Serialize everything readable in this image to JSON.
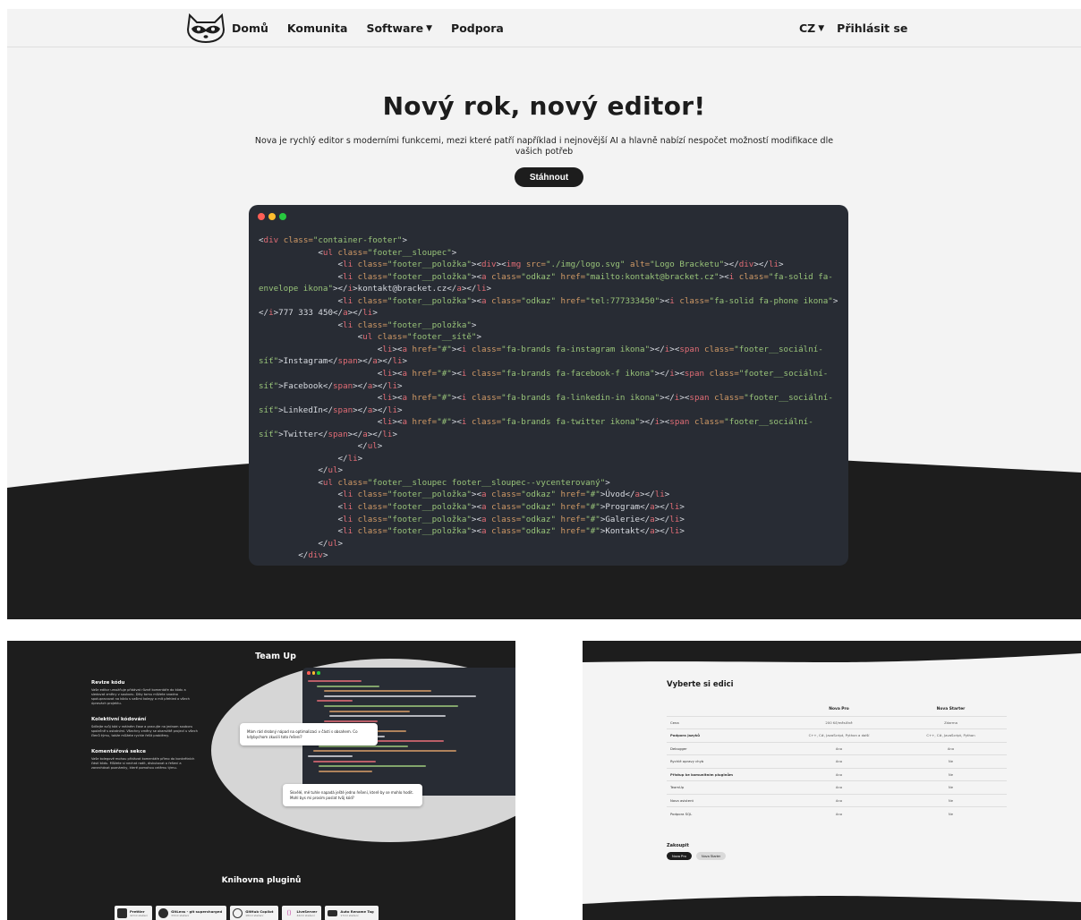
{
  "nav": {
    "items": [
      {
        "label": "Domů"
      },
      {
        "label": "Komunita"
      },
      {
        "label": "Software",
        "caret": "▼"
      },
      {
        "label": "Podpora"
      }
    ],
    "language": {
      "label": "CZ",
      "caret": "▼"
    },
    "login": "Přihlásit se"
  },
  "hero": {
    "title": "Nový rok, nový editor!",
    "subtitle": "Nova je rychlý editor s moderními funkcemi, mezi které patří například i nejnovější AI a hlavně nabízí nespočet možností modifikace dle vašich potřeb",
    "download_button": "Stáhnout"
  },
  "code_window": {
    "dots": [
      "#ff5f56",
      "#ffbd2e",
      "#27c93f"
    ],
    "lines": [
      [
        [
          "t",
          "<"
        ],
        [
          "r",
          "div "
        ],
        [
          "a",
          "class="
        ],
        [
          "s",
          "\"container-footer\""
        ],
        [
          "t",
          ">"
        ]
      ],
      [
        [
          "t",
          "            <"
        ],
        [
          "r",
          "ul "
        ],
        [
          "a",
          "class="
        ],
        [
          "s",
          "\"footer__sloupec\""
        ],
        [
          "t",
          ">"
        ]
      ],
      [
        [
          "t",
          "                <"
        ],
        [
          "r",
          "li "
        ],
        [
          "a",
          "class="
        ],
        [
          "s",
          "\"footer__položka\""
        ],
        [
          "t",
          "><"
        ],
        [
          "r",
          "div"
        ],
        [
          "t",
          "><"
        ],
        [
          "r",
          "img "
        ],
        [
          "a",
          "src="
        ],
        [
          "s",
          "\"./img/logo.svg\" "
        ],
        [
          "a",
          "alt="
        ],
        [
          "s",
          "\"Logo Bracketu\""
        ],
        [
          "t",
          "></"
        ],
        [
          "r",
          "div"
        ],
        [
          "t",
          "></"
        ],
        [
          "r",
          "li"
        ],
        [
          "t",
          ">"
        ]
      ],
      [
        [
          "t",
          "                <"
        ],
        [
          "r",
          "li "
        ],
        [
          "a",
          "class="
        ],
        [
          "s",
          "\"footer__položka\""
        ],
        [
          "t",
          "><"
        ],
        [
          "r",
          "a "
        ],
        [
          "a",
          "class="
        ],
        [
          "s",
          "\"odkaz\" "
        ],
        [
          "a",
          "href="
        ],
        [
          "s",
          "\"mailto:kontakt@bracket.cz\""
        ],
        [
          "t",
          "><"
        ],
        [
          "r",
          "i "
        ],
        [
          "a",
          "class="
        ],
        [
          "s",
          "\"fa-solid fa-"
        ]
      ],
      [
        [
          "s",
          "envelope ikona\""
        ],
        [
          "t",
          "></"
        ],
        [
          "r",
          "i"
        ],
        [
          "t",
          ">kontakt@bracket.cz</"
        ],
        [
          "r",
          "a"
        ],
        [
          "t",
          "></"
        ],
        [
          "r",
          "li"
        ],
        [
          "t",
          ">"
        ]
      ],
      [
        [
          "t",
          "                <"
        ],
        [
          "r",
          "li "
        ],
        [
          "a",
          "class="
        ],
        [
          "s",
          "\"footer__položka\""
        ],
        [
          "t",
          "><"
        ],
        [
          "r",
          "a "
        ],
        [
          "a",
          "class="
        ],
        [
          "s",
          "\"odkaz\" "
        ],
        [
          "a",
          "href="
        ],
        [
          "s",
          "\"tel:777333450\""
        ],
        [
          "t",
          "><"
        ],
        [
          "r",
          "i "
        ],
        [
          "a",
          "class="
        ],
        [
          "s",
          "\"fa-solid fa-phone ikona\""
        ],
        [
          "t",
          ">"
        ]
      ],
      [
        [
          "t",
          "</"
        ],
        [
          "r",
          "i"
        ],
        [
          "t",
          ">777 333 450</"
        ],
        [
          "r",
          "a"
        ],
        [
          "t",
          "></"
        ],
        [
          "r",
          "li"
        ],
        [
          "t",
          ">"
        ]
      ],
      [
        [
          "t",
          "                <"
        ],
        [
          "r",
          "li "
        ],
        [
          "a",
          "class="
        ],
        [
          "s",
          "\"footer__položka\""
        ],
        [
          "t",
          ">"
        ]
      ],
      [
        [
          "t",
          "                    <"
        ],
        [
          "r",
          "ul "
        ],
        [
          "a",
          "class="
        ],
        [
          "s",
          "\"footer__sítě\""
        ],
        [
          "t",
          ">"
        ]
      ],
      [
        [
          "t",
          "                        <"
        ],
        [
          "r",
          "li"
        ],
        [
          "t",
          "><"
        ],
        [
          "r",
          "a "
        ],
        [
          "a",
          "href="
        ],
        [
          "s",
          "\"#\""
        ],
        [
          "t",
          "><"
        ],
        [
          "r",
          "i "
        ],
        [
          "a",
          "class="
        ],
        [
          "s",
          "\"fa-brands fa-instagram ikona\""
        ],
        [
          "t",
          "></"
        ],
        [
          "r",
          "i"
        ],
        [
          "t",
          "><"
        ],
        [
          "r",
          "span "
        ],
        [
          "a",
          "class="
        ],
        [
          "s",
          "\"footer__sociální-"
        ]
      ],
      [
        [
          "s",
          "síť\""
        ],
        [
          "t",
          ">Instagram</"
        ],
        [
          "r",
          "span"
        ],
        [
          "t",
          "></"
        ],
        [
          "r",
          "a"
        ],
        [
          "t",
          "></"
        ],
        [
          "r",
          "li"
        ],
        [
          "t",
          ">"
        ]
      ],
      [
        [
          "t",
          "                        <"
        ],
        [
          "r",
          "li"
        ],
        [
          "t",
          "><"
        ],
        [
          "r",
          "a "
        ],
        [
          "a",
          "href="
        ],
        [
          "s",
          "\"#\""
        ],
        [
          "t",
          "><"
        ],
        [
          "r",
          "i "
        ],
        [
          "a",
          "class="
        ],
        [
          "s",
          "\"fa-brands fa-facebook-f ikona\""
        ],
        [
          "t",
          "></"
        ],
        [
          "r",
          "i"
        ],
        [
          "t",
          "><"
        ],
        [
          "r",
          "span "
        ],
        [
          "a",
          "class="
        ],
        [
          "s",
          "\"footer__sociální-"
        ]
      ],
      [
        [
          "s",
          "síť\""
        ],
        [
          "t",
          ">Facebook</"
        ],
        [
          "r",
          "span"
        ],
        [
          "t",
          "></"
        ],
        [
          "r",
          "a"
        ],
        [
          "t",
          "></"
        ],
        [
          "r",
          "li"
        ],
        [
          "t",
          ">"
        ]
      ],
      [
        [
          "t",
          "                        <"
        ],
        [
          "r",
          "li"
        ],
        [
          "t",
          "><"
        ],
        [
          "r",
          "a "
        ],
        [
          "a",
          "href="
        ],
        [
          "s",
          "\"#\""
        ],
        [
          "t",
          "><"
        ],
        [
          "r",
          "i "
        ],
        [
          "a",
          "class="
        ],
        [
          "s",
          "\"fa-brands fa-linkedin-in ikona\""
        ],
        [
          "t",
          "></"
        ],
        [
          "r",
          "i"
        ],
        [
          "t",
          "><"
        ],
        [
          "r",
          "span "
        ],
        [
          "a",
          "class="
        ],
        [
          "s",
          "\"footer__sociální-"
        ]
      ],
      [
        [
          "s",
          "síť\""
        ],
        [
          "t",
          ">LinkedIn</"
        ],
        [
          "r",
          "span"
        ],
        [
          "t",
          "></"
        ],
        [
          "r",
          "a"
        ],
        [
          "t",
          "></"
        ],
        [
          "r",
          "li"
        ],
        [
          "t",
          ">"
        ]
      ],
      [
        [
          "t",
          "                        <"
        ],
        [
          "r",
          "li"
        ],
        [
          "t",
          "><"
        ],
        [
          "r",
          "a "
        ],
        [
          "a",
          "href="
        ],
        [
          "s",
          "\"#\""
        ],
        [
          "t",
          "><"
        ],
        [
          "r",
          "i "
        ],
        [
          "a",
          "class="
        ],
        [
          "s",
          "\"fa-brands fa-twitter ikona\""
        ],
        [
          "t",
          "></"
        ],
        [
          "r",
          "i"
        ],
        [
          "t",
          "><"
        ],
        [
          "r",
          "span "
        ],
        [
          "a",
          "class="
        ],
        [
          "s",
          "\"footer__sociální-"
        ]
      ],
      [
        [
          "s",
          "síť\""
        ],
        [
          "t",
          ">Twitter</"
        ],
        [
          "r",
          "span"
        ],
        [
          "t",
          "></"
        ],
        [
          "r",
          "a"
        ],
        [
          "t",
          "></"
        ],
        [
          "r",
          "li"
        ],
        [
          "t",
          ">"
        ]
      ],
      [
        [
          "t",
          "                    </"
        ],
        [
          "r",
          "ul"
        ],
        [
          "t",
          ">"
        ]
      ],
      [
        [
          "t",
          "                </"
        ],
        [
          "r",
          "li"
        ],
        [
          "t",
          ">"
        ]
      ],
      [
        [
          "t",
          "            </"
        ],
        [
          "r",
          "ul"
        ],
        [
          "t",
          ">"
        ]
      ],
      [
        [
          "t",
          "            <"
        ],
        [
          "r",
          "ul "
        ],
        [
          "a",
          "class="
        ],
        [
          "s",
          "\"footer__sloupec footer__sloupec--vycenterovaný\""
        ],
        [
          "t",
          ">"
        ]
      ],
      [
        [
          "t",
          "                <"
        ],
        [
          "r",
          "li "
        ],
        [
          "a",
          "class="
        ],
        [
          "s",
          "\"footer__položka\""
        ],
        [
          "t",
          "><"
        ],
        [
          "r",
          "a "
        ],
        [
          "a",
          "class="
        ],
        [
          "s",
          "\"odkaz\" "
        ],
        [
          "a",
          "href="
        ],
        [
          "s",
          "\"#\""
        ],
        [
          "t",
          ">Úvod</"
        ],
        [
          "r",
          "a"
        ],
        [
          "t",
          "></"
        ],
        [
          "r",
          "li"
        ],
        [
          "t",
          ">"
        ]
      ],
      [
        [
          "t",
          "                <"
        ],
        [
          "r",
          "li "
        ],
        [
          "a",
          "class="
        ],
        [
          "s",
          "\"footer__položka\""
        ],
        [
          "t",
          "><"
        ],
        [
          "r",
          "a "
        ],
        [
          "a",
          "class="
        ],
        [
          "s",
          "\"odkaz\" "
        ],
        [
          "a",
          "href="
        ],
        [
          "s",
          "\"#\""
        ],
        [
          "t",
          ">Program</"
        ],
        [
          "r",
          "a"
        ],
        [
          "t",
          "></"
        ],
        [
          "r",
          "li"
        ],
        [
          "t",
          ">"
        ]
      ],
      [
        [
          "t",
          "                <"
        ],
        [
          "r",
          "li "
        ],
        [
          "a",
          "class="
        ],
        [
          "s",
          "\"footer__položka\""
        ],
        [
          "t",
          "><"
        ],
        [
          "r",
          "a "
        ],
        [
          "a",
          "class="
        ],
        [
          "s",
          "\"odkaz\" "
        ],
        [
          "a",
          "href="
        ],
        [
          "s",
          "\"#\""
        ],
        [
          "t",
          ">Galerie</"
        ],
        [
          "r",
          "a"
        ],
        [
          "t",
          "></"
        ],
        [
          "r",
          "li"
        ],
        [
          "t",
          ">"
        ]
      ],
      [
        [
          "t",
          "                <"
        ],
        [
          "r",
          "li "
        ],
        [
          "a",
          "class="
        ],
        [
          "s",
          "\"footer__položka\""
        ],
        [
          "t",
          "><"
        ],
        [
          "r",
          "a "
        ],
        [
          "a",
          "class="
        ],
        [
          "s",
          "\"odkaz\" "
        ],
        [
          "a",
          "href="
        ],
        [
          "s",
          "\"#\""
        ],
        [
          "t",
          ">Kontakt</"
        ],
        [
          "r",
          "a"
        ],
        [
          "t",
          "></"
        ],
        [
          "r",
          "li"
        ],
        [
          "t",
          ">"
        ]
      ],
      [
        [
          "t",
          "            </"
        ],
        [
          "r",
          "ul"
        ],
        [
          "t",
          ">"
        ]
      ],
      [
        [
          "t",
          "        </"
        ],
        [
          "r",
          "div"
        ],
        [
          "t",
          ">"
        ]
      ]
    ]
  },
  "team": {
    "title": "Team Up",
    "features": [
      {
        "title": "Revize kódu",
        "text": "Vaše editor umožňuje přidávat různé komentáře do kódu a sledovat změny v souboru. Díky tomu můžete snadno spolupracovat na kódu s vašimi kolegy a mít přehled o všech úpravách projektu."
      },
      {
        "title": "Kolektivní kódování",
        "text": "Sdílejte svůj kód v reálném čase a pracujte na jednom souboru společně s ostatními. Všechny změny se okamžitě projeví u všech členů týmu, takže můžete rychle řešit problémy."
      },
      {
        "title": "Komentářová sekce",
        "text": "Vaše kolegové mohou přidávat komentáře přímo do konkrétních částí kódu. Můžete si nechat radit, diskutovat o řešení a zanechávat poznámky, které pomohou celému týmu."
      }
    ],
    "bubble_top": "Mám rád drobný nápad na optimalizaci v části s obsahem. Co kdybychom zkusili toto řešení?",
    "bubble_bottom": "Skvělé, mě tuhle napadá ještě jedno řešení, které by se mohlo hodit. Mohl bys mi prosím poslat tvůj kód?",
    "plugins_title": "Knihovna pluginů",
    "plugins": [
      {
        "name": "Prettier",
        "sub": "42mil stažení"
      },
      {
        "name": "GitLens - git supercharged",
        "sub": "33mil stažení"
      },
      {
        "name": "GitHub Copilot",
        "sub": "18mil stažení"
      },
      {
        "name": "LiveServer",
        "sub": "42mil stažení"
      },
      {
        "name": "Auto Rename Tag",
        "sub": "17mil stažení"
      }
    ]
  },
  "editions": {
    "title": "Vyberte si edici",
    "columns": [
      "",
      "Nova Pro",
      "Nova Starter"
    ],
    "rows": [
      [
        "Cena",
        "200 Kč/měsíčně",
        "Zdarma"
      ],
      [
        "Podpora jazyků",
        "C++, C#, JavaScript, Python a další",
        "C++, C#, JavaScript, Python"
      ],
      [
        "Debugger",
        "Ano",
        "Ano"
      ],
      [
        "Rychlé opravy chyb",
        "Ano",
        "Ne"
      ],
      [
        "Přístup ke komunitním pluginům",
        "Ano",
        "Ne"
      ],
      [
        "TeamUp",
        "Ano",
        "Ne"
      ],
      [
        "Nova asistent",
        "Ano",
        "Ne"
      ],
      [
        "Podpora SQL",
        "Ano",
        "Ne"
      ]
    ],
    "buy_title": "Zakoupit",
    "buy_buttons": [
      "Nova Pro",
      "Nova Starter"
    ]
  }
}
